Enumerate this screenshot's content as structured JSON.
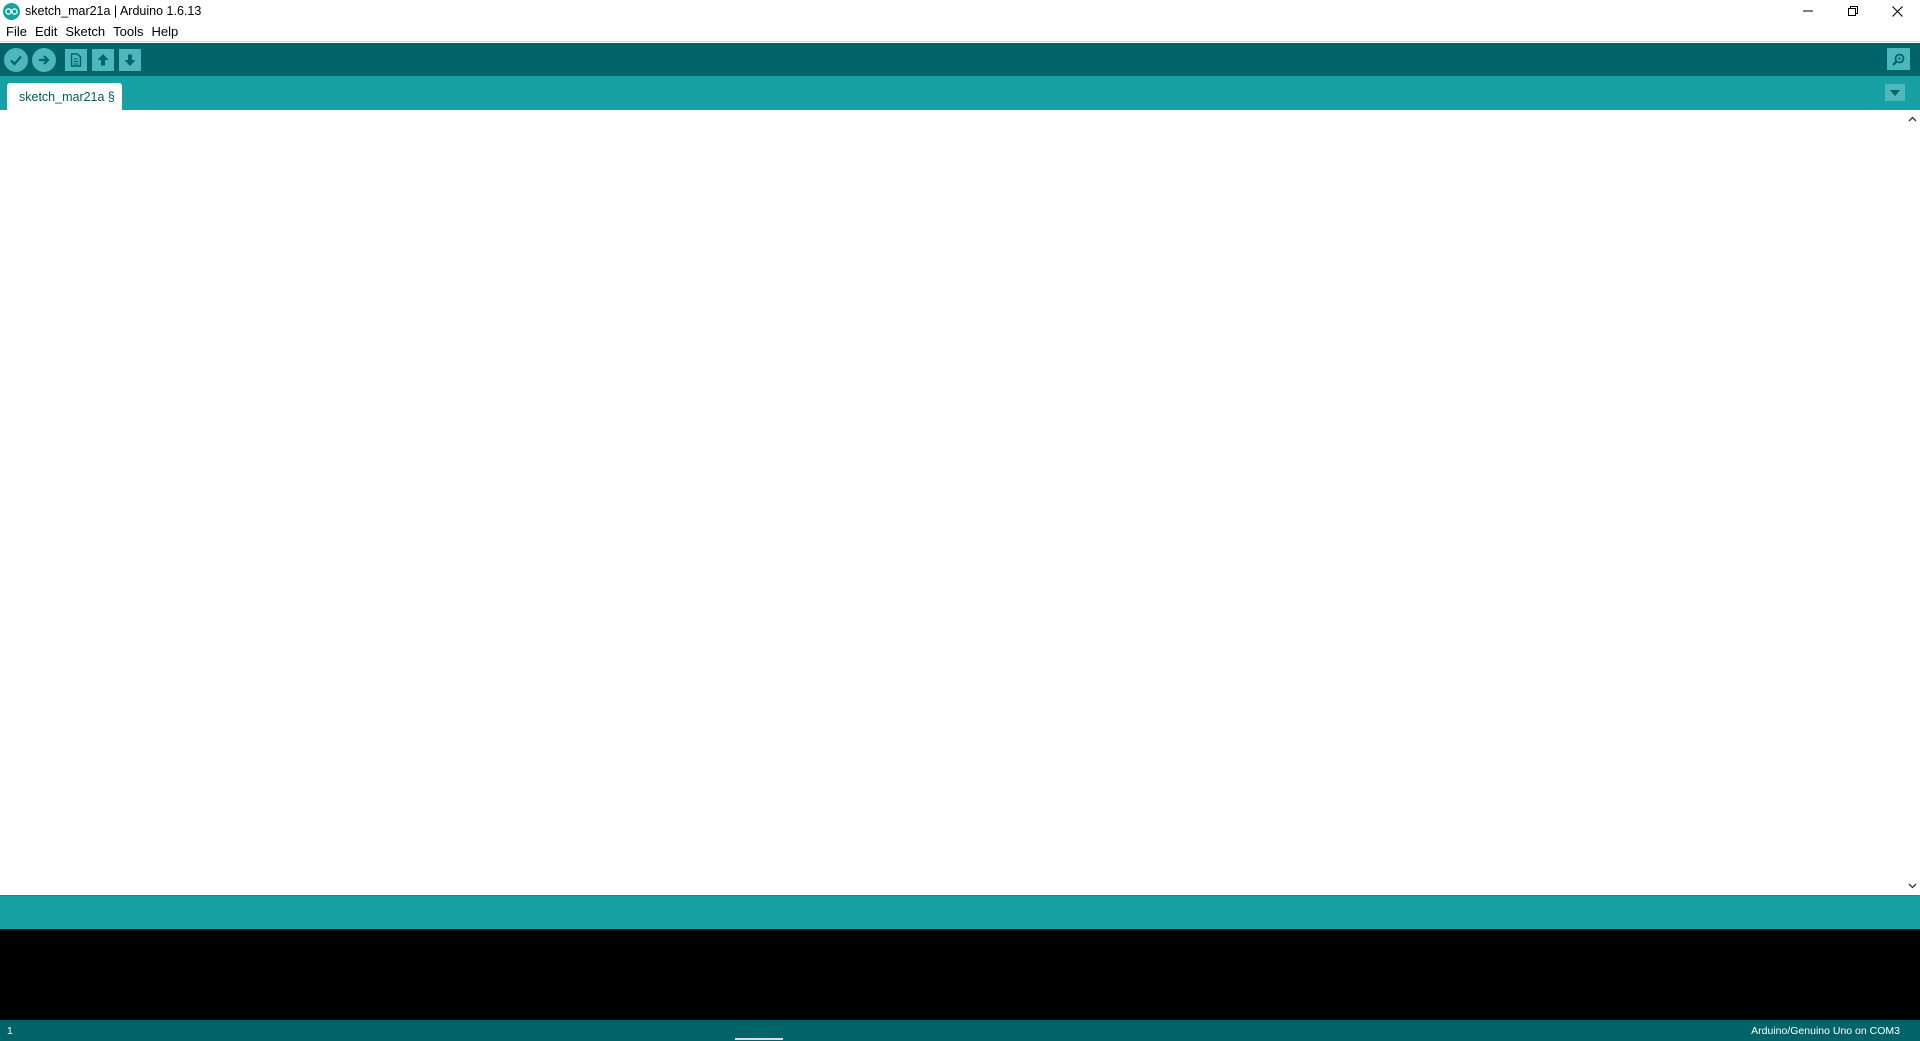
{
  "window": {
    "title": "sketch_mar21a | Arduino 1.6.13",
    "logo_icon": "arduino-logo-icon",
    "controls": [
      "minimize-icon",
      "restore-icon",
      "close-icon"
    ]
  },
  "menubar": {
    "items": [
      {
        "label": "File"
      },
      {
        "label": "Edit"
      },
      {
        "label": "Sketch"
      },
      {
        "label": "Tools"
      },
      {
        "label": "Help"
      }
    ]
  },
  "toolbar": {
    "buttons": [
      {
        "icon": "checkmark-icon",
        "action": "verify"
      },
      {
        "icon": "arrow-right-icon",
        "action": "upload"
      },
      {
        "icon": "new-file-icon",
        "action": "new"
      },
      {
        "icon": "arrow-up-icon",
        "action": "open"
      },
      {
        "icon": "arrow-down-icon",
        "action": "save"
      }
    ],
    "serial_monitor_icon": "magnifier-icon"
  },
  "tabs": {
    "items": [
      {
        "label": "sketch_mar21a §"
      }
    ],
    "menu_icon": "triangle-down-icon"
  },
  "editor": {
    "content": ""
  },
  "console": {
    "output": ""
  },
  "status": {
    "line_number": "1",
    "board_info": "Arduino/Genuino Uno on COM3"
  },
  "colors": {
    "toolbar_bg": "#006468",
    "accent": "#17a1a5",
    "button_fill": "#4db7bb",
    "console_bg": "#000000"
  }
}
